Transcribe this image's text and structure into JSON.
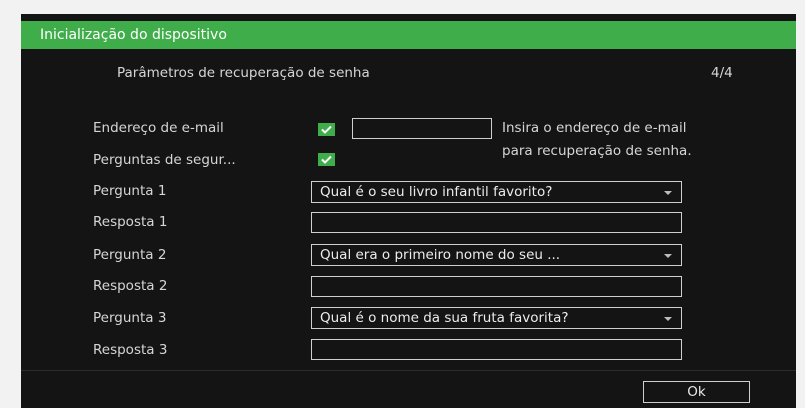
{
  "dialog": {
    "title": "Inicialização do dispositivo",
    "heading": "Parâmetros de recuperação de senha",
    "step": "4/4"
  },
  "form": {
    "email_label": "Endereço de e-mail",
    "email_value": "",
    "email_hint_line1": "Insira o endereço de e-mail",
    "email_hint_line2": "para recuperação de senha.",
    "security_label": "Perguntas de segur...",
    "email_checked": true,
    "security_checked": true,
    "q1_label": "Pergunta 1",
    "q1_value": "Qual é o seu livro infantil favorito?",
    "a1_label": "Resposta 1",
    "a1_value": "",
    "q2_label": "Pergunta 2",
    "q2_value": "Qual era o primeiro nome do seu ...",
    "a2_label": "Resposta 2",
    "a2_value": "",
    "q3_label": "Pergunta 3",
    "q3_value": "Qual é o nome da sua fruta favorita?",
    "a3_label": "Resposta 3",
    "a3_value": ""
  },
  "footer": {
    "ok_label": "Ok"
  },
  "colors": {
    "accent": "#3fae4a",
    "background": "#141414"
  },
  "icons": {
    "check": "check-icon",
    "dropdown": "chevron-down-icon"
  }
}
